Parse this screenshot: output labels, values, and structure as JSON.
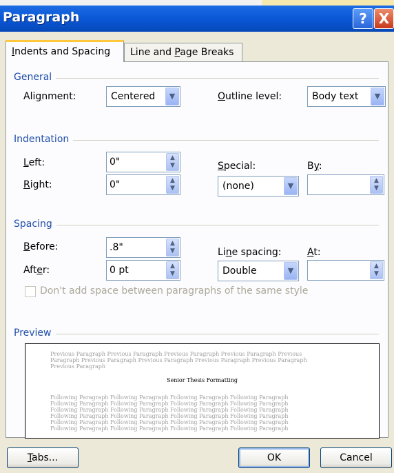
{
  "window": {
    "title": "Paragraph",
    "help_glyph": "?",
    "close_glyph": "X"
  },
  "tabs": [
    {
      "label": "Indents and Spacing",
      "mnemonic": "I",
      "rest": "ndents and Spacing",
      "active": true
    },
    {
      "label": "Line and Page Breaks",
      "pre": "Line and ",
      "mnemonic": "P",
      "rest": "age Breaks",
      "active": false
    }
  ],
  "general": {
    "heading": "General",
    "alignment": {
      "pre": "Ali",
      "mnemonic": "g",
      "rest": "nment:",
      "value": "Centered"
    },
    "outline_level": {
      "mnemonic": "O",
      "rest": "utline level:",
      "value": "Body text"
    }
  },
  "indentation": {
    "heading": "Indentation",
    "left": {
      "mnemonic": "L",
      "rest": "eft:",
      "value": "0\""
    },
    "right": {
      "mnemonic": "R",
      "rest": "ight:",
      "value": "0\""
    },
    "special": {
      "mnemonic": "S",
      "rest": "pecial:",
      "value": "(none)"
    },
    "by": {
      "pre": "B",
      "mnemonic": "y",
      "rest": ":",
      "value": ""
    }
  },
  "spacing": {
    "heading": "Spacing",
    "before": {
      "mnemonic": "B",
      "rest": "efore:",
      "value": ".8\""
    },
    "after": {
      "pre": "Aft",
      "mnemonic": "e",
      "rest": "r:",
      "value": "0 pt"
    },
    "line_spacing": {
      "pre": "Li",
      "mnemonic": "n",
      "rest": "e spacing:",
      "value": "Double"
    },
    "at": {
      "mnemonic": "A",
      "rest": "t:",
      "value": ""
    },
    "dont_add_space": {
      "label": "Don't add space between paragraphs of the same style",
      "checked": false
    }
  },
  "preview": {
    "heading": "Preview",
    "previous_text": "Previous Paragraph Previous Paragraph Previous Paragraph Previous Paragraph Previous",
    "previous_text2": "Paragraph Previous Paragraph Previous Paragraph Previous Paragraph Previous Paragraph",
    "previous_text3": "Previous Paragraph",
    "current_text": "Senior Thesis Formatting",
    "following_text": "Following Paragraph Following Paragraph Following Paragraph Following Paragraph"
  },
  "buttons": {
    "tabs": {
      "mnemonic": "T",
      "rest": "abs..."
    },
    "ok": "OK",
    "cancel": "Cancel"
  },
  "icons": {
    "dropdown": "▼",
    "spin_up": "▲",
    "spin_down": "▼"
  }
}
